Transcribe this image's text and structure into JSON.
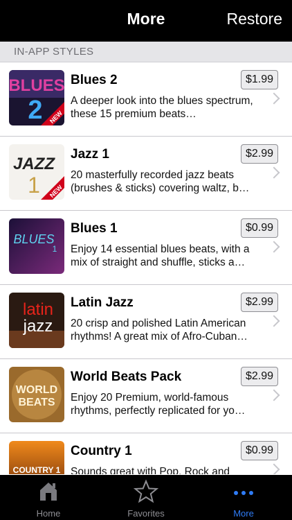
{
  "navbar": {
    "title": "More",
    "restore_label": "Restore"
  },
  "section": {
    "header": "IN-APP STYLES"
  },
  "items": [
    {
      "title": "Blues 2",
      "price": "$1.99",
      "description": "A deeper look into the blues spectrum, these 15 premium beats…",
      "thumb_text": "BLUES",
      "thumb_text2": "2",
      "badge": "NEW"
    },
    {
      "title": "Jazz 1",
      "price": "$2.99",
      "description": "20 masterfully recorded jazz beats (brushes & sticks) covering waltz, b…",
      "thumb_text": "JAZZ",
      "thumb_text2": "1",
      "badge": "NEW"
    },
    {
      "title": "Blues 1",
      "price": "$0.99",
      "description": "Enjoy 14 essential blues beats, with a mix of straight and shuffle, sticks a…",
      "thumb_text": "BLUES",
      "thumb_text2": "1"
    },
    {
      "title": "Latin Jazz",
      "price": "$2.99",
      "description": "20 crisp and polished Latin American rhythms! A great mix of Afro-Cuban…",
      "thumb_text": "latin",
      "thumb_text2": "jazz"
    },
    {
      "title": "World Beats Pack",
      "price": "$2.99",
      "description": "Enjoy 20 Premium, world-famous rhythms, perfectly replicated for yo…",
      "thumb_text": "WORLD",
      "thumb_text2": "BEATS"
    },
    {
      "title": "Country 1",
      "price": "$0.99",
      "description": "Sounds great with Pop, Rock and",
      "thumb_text": "COUNTRY 1"
    }
  ],
  "tabs": [
    {
      "label": "Home",
      "icon": "home-icon"
    },
    {
      "label": "Favorites",
      "icon": "star-icon"
    },
    {
      "label": "More",
      "icon": "more-icon"
    }
  ],
  "colors": {
    "accent": "#2f7cf6",
    "navbar": "#000000",
    "tab_inactive": "#8e8e93"
  }
}
